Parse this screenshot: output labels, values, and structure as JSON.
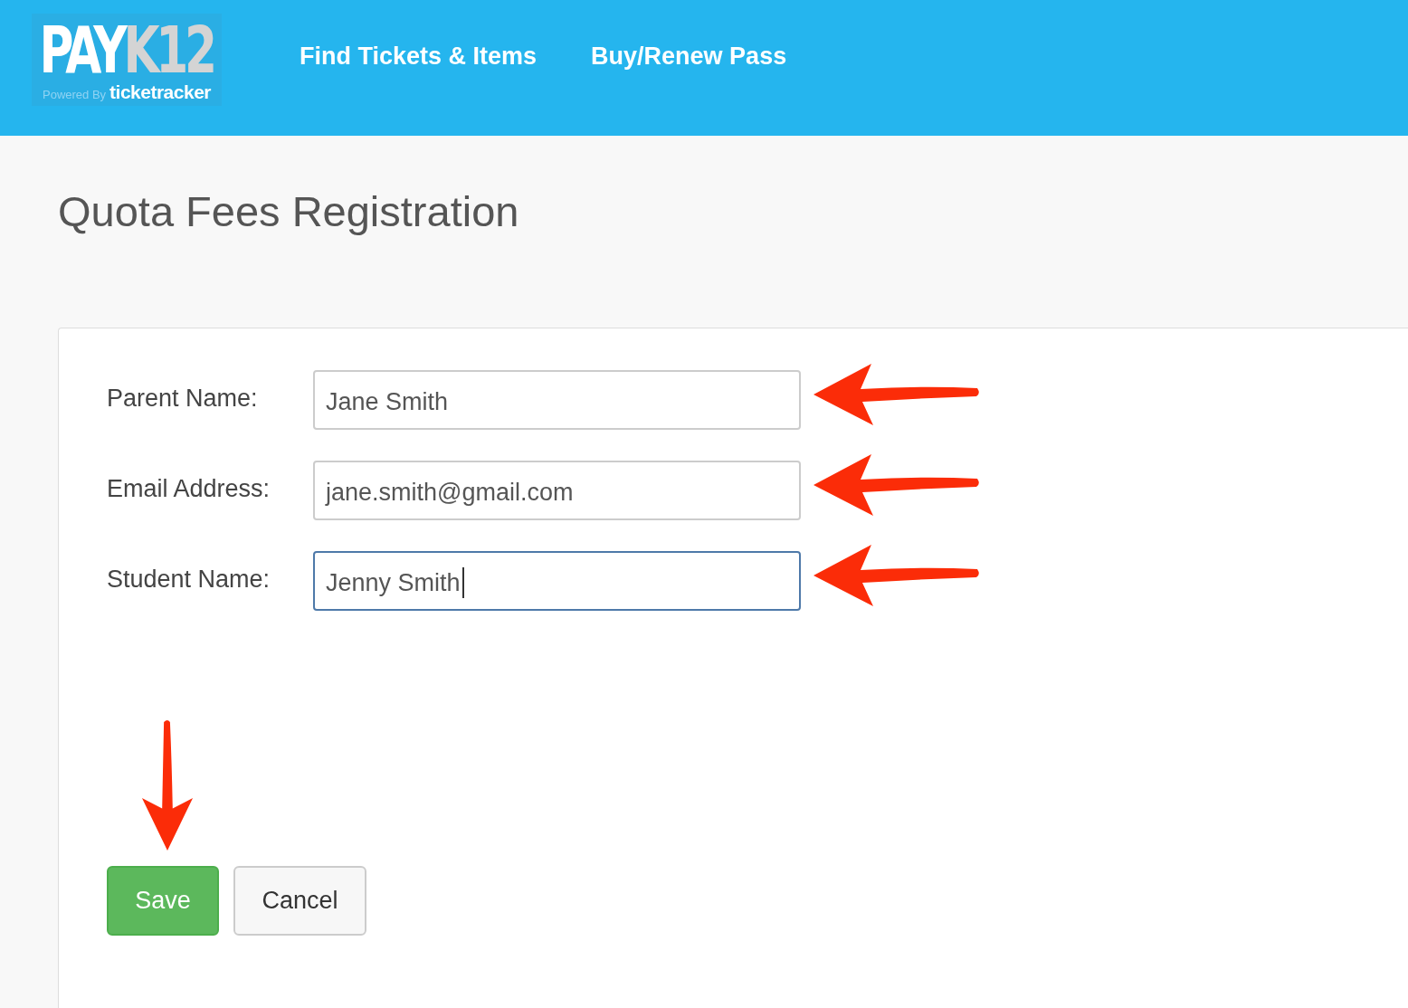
{
  "header": {
    "logo": {
      "primary": "PAY",
      "secondary": "K12",
      "tagline_prefix": "Powered By",
      "tagline_brand": "ticketracker"
    },
    "nav": [
      {
        "label": "Find Tickets & Items"
      },
      {
        "label": "Buy/Renew Pass"
      }
    ]
  },
  "page": {
    "title": "Quota Fees Registration"
  },
  "form": {
    "fields": [
      {
        "label": "Parent Name:",
        "value": "Jane Smith",
        "focused": false,
        "callout_arrow": true
      },
      {
        "label": "Email Address:",
        "value": "jane.smith@gmail.com",
        "focused": false,
        "callout_arrow": true
      },
      {
        "label": "Student Name:",
        "value": "Jenny Smith",
        "focused": true,
        "callout_arrow": true
      }
    ],
    "buttons": [
      {
        "label": "Save",
        "kind": "primary",
        "callout_arrow": true
      },
      {
        "label": "Cancel",
        "kind": "default",
        "callout_arrow": false
      }
    ]
  }
}
